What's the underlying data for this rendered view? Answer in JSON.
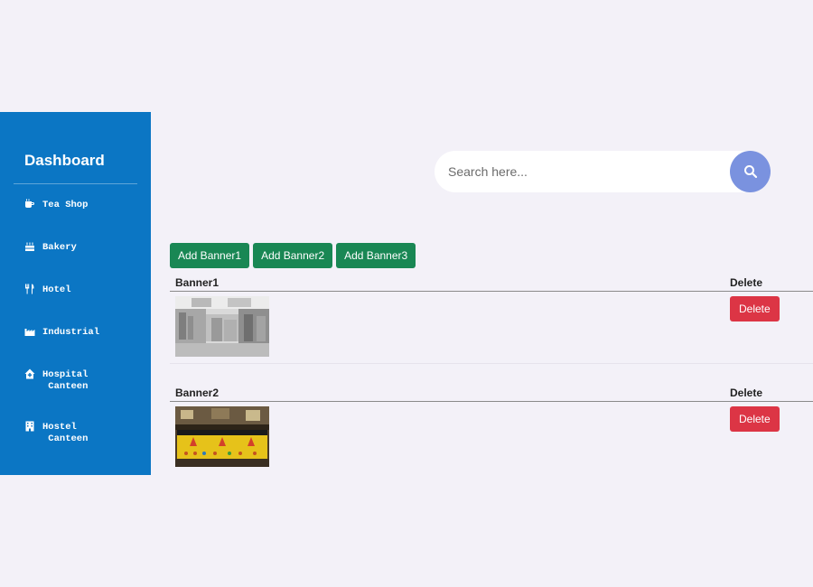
{
  "sidebar": {
    "brand": "Dashboard",
    "items": [
      {
        "label": "Tea Shop",
        "icon": "coffee-cup-icon"
      },
      {
        "label": "Bakery",
        "icon": "cake-icon"
      },
      {
        "label": "Hotel",
        "icon": "utensils-icon"
      },
      {
        "label": "Industrial",
        "icon": "factory-icon"
      },
      {
        "label": "Hospital\n Canteen",
        "icon": "home-medical-icon"
      },
      {
        "label": "Hostel\n Canteen",
        "icon": "building-icon"
      }
    ]
  },
  "search": {
    "placeholder": "Search here...",
    "icon": "search-icon"
  },
  "actions": [
    "Add Banner1",
    "Add Banner2",
    "Add Banner3"
  ],
  "banners": [
    {
      "header": "Banner1",
      "delete_header": "Delete",
      "delete_label": "Delete",
      "image": "commercial-kitchen-photo"
    },
    {
      "header": "Banner2",
      "delete_header": "Delete",
      "delete_label": "Delete",
      "image": "food-counter-photo"
    }
  ],
  "colors": {
    "sidebar": "#0b76c4",
    "add_button": "#198754",
    "delete_button": "#dc3545",
    "search_button": "#7a92df"
  }
}
